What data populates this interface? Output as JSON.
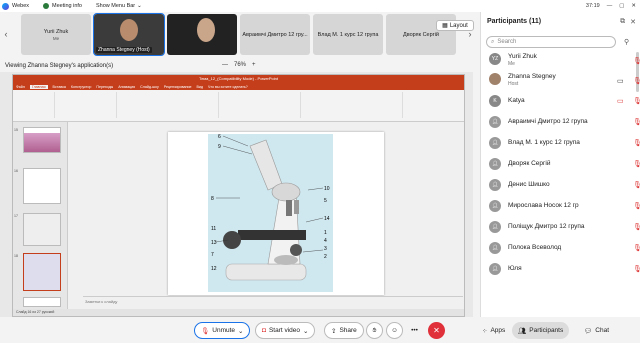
{
  "topbar": {
    "app": "Webex",
    "meeting_info": "Meeting info",
    "show_menu": "Show Menu Bar",
    "time": "37:19"
  },
  "strip": {
    "tiles": [
      {
        "name": "Yurii Zhuk",
        "sub": "Me"
      },
      {
        "name": "Zhanna Stegney (Host)"
      },
      {
        "name": ""
      },
      {
        "name": "Авраимчі Дмитро 12 гру..."
      },
      {
        "name": "Влад М. 1 курс 12 група"
      },
      {
        "name": "Дворяк Сергій"
      }
    ],
    "layout_label": "Layout"
  },
  "share": {
    "title": "Viewing Zhanna Stegney's application(s)",
    "zoom_minus": "—",
    "zoom_value": "76%",
    "zoom_plus": "+"
  },
  "ppt": {
    "window_title": "Тема_12_(Compatibility Mode) - PowerPoint",
    "tabs": [
      "Файл",
      "Главная",
      "Вставка",
      "Конструктор",
      "Переходы",
      "Анимация",
      "Слайд-шоу",
      "Рецензирование",
      "Вид",
      "Что вы хотите сделать?"
    ],
    "notes": "Заметки к слайду",
    "status": "Слайд 16 из 27  русский"
  },
  "controls": {
    "unmute": "Unmute",
    "start_video": "Start video",
    "share": "Share",
    "apps": "Apps",
    "participants": "Participants",
    "chat": "Chat"
  },
  "panel": {
    "title": "Participants (11)",
    "search_placeholder": "Search",
    "participants": [
      {
        "name": "Yurii Zhuk",
        "sub": "Me",
        "initials": "YZ"
      },
      {
        "name": "Zhanna Stegney",
        "sub": "Host",
        "initials": ""
      },
      {
        "name": "Katya",
        "sub": "",
        "initials": "K"
      },
      {
        "name": "Авраимчі Дмитро 12 група",
        "sub": "",
        "initials": ""
      },
      {
        "name": "Влад М. 1 курс 12 група",
        "sub": "",
        "initials": ""
      },
      {
        "name": "Дворяк Сергій",
        "sub": "",
        "initials": ""
      },
      {
        "name": "Денис Шишко",
        "sub": "",
        "initials": ""
      },
      {
        "name": "Мирослава Носок 12 гр",
        "sub": "",
        "initials": ""
      },
      {
        "name": "Поліщук Дмитро 12 група",
        "sub": "",
        "initials": ""
      },
      {
        "name": "Полока Всеволод",
        "sub": "",
        "initials": ""
      },
      {
        "name": "Юля",
        "sub": "",
        "initials": ""
      }
    ]
  },
  "slide_labels": [
    "6",
    "9",
    "8",
    "10",
    "5",
    "14",
    "11",
    "13",
    "1",
    "4",
    "3",
    "2",
    "7",
    "12"
  ]
}
